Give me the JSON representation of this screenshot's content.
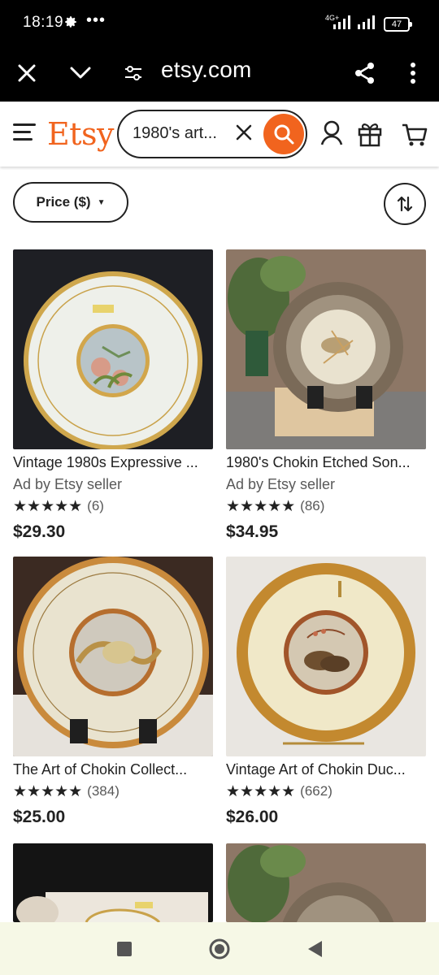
{
  "status": {
    "time": "18:19",
    "network": "4G+",
    "battery": "47"
  },
  "browser": {
    "url": "etsy.com"
  },
  "header": {
    "logo": "Etsy",
    "search_query": "1980's art..."
  },
  "filters": {
    "price_label": "Price ($)"
  },
  "listings": [
    {
      "title": "Vintage 1980s Expressive ...",
      "ad": "Ad by Etsy seller",
      "stars": "★★★★★",
      "reviews": "(6)",
      "price": "$29.30"
    },
    {
      "title": "1980's Chokin Etched Son...",
      "ad": "Ad by Etsy seller",
      "stars": "★★★★★",
      "reviews": "(86)",
      "price": "$34.95"
    },
    {
      "title": "The Art of Chokin Collect...",
      "stars": "★★★★★",
      "reviews": "(384)",
      "price": "$25.00"
    },
    {
      "title": "Vintage Art of Chokin Duc...",
      "stars": "★★★★★",
      "reviews": "(662)",
      "price": "$26.00"
    }
  ],
  "colors": {
    "brand": "#F1641E",
    "text": "#222222",
    "muted": "#595959",
    "navbar_bg": "#f6f8e6"
  },
  "icons": {
    "close": "close-icon",
    "collapse": "chevron-down-icon",
    "site_settings": "tune-icon",
    "share": "share-icon",
    "menu": "more-vert-icon",
    "search": "search-icon",
    "account": "account-icon",
    "gift": "gift-icon",
    "cart": "cart-icon",
    "sort": "sort-icon"
  }
}
